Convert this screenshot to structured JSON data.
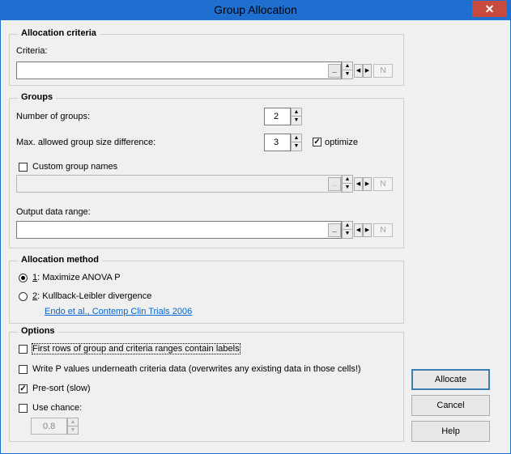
{
  "window": {
    "title": "Group Allocation",
    "close_label": "✕"
  },
  "allocation_criteria": {
    "legend": "Allocation criteria",
    "criteria_label": "Criteria:",
    "criteria_value": "",
    "collapse_label": "_",
    "n_label": "N"
  },
  "groups": {
    "legend": "Groups",
    "num_groups_label": "Number of groups:",
    "num_groups_value": "2",
    "max_diff_label": "Max. allowed group size difference:",
    "max_diff_value": "3",
    "optimize_label": "optimize",
    "optimize_checked": true,
    "custom_names_label": "Custom group names",
    "custom_names_checked": false,
    "custom_names_value": "",
    "output_label": "Output data range:",
    "output_value": "",
    "collapse_label": "_",
    "n_label": "N"
  },
  "allocation_method": {
    "legend": "Allocation method",
    "options": [
      {
        "key": "1",
        "label": ": Maximize ANOVA P",
        "selected": true
      },
      {
        "key": "2",
        "label": ": Kullback-Leibler divergence",
        "selected": false
      }
    ],
    "reference_link": "Endo et al., Contemp Clin Trials 2006"
  },
  "options": {
    "legend": "Options",
    "first_rows_label": "First rows of group and criteria ranges contain labels",
    "first_rows_checked": false,
    "write_p_label": "Write P values underneath criteria data (overwrites any existing data in those cells!)",
    "write_p_checked": false,
    "presort_label": "Pre-sort (slow)",
    "presort_checked": true,
    "use_chance_label": "Use chance:",
    "use_chance_checked": false,
    "chance_value": "0.8"
  },
  "buttons": {
    "allocate": "Allocate",
    "cancel": "Cancel",
    "help": "Help"
  },
  "check_mark": "✓",
  "arrows": {
    "up": "▲",
    "down": "▼",
    "left": "◀",
    "right": "▶"
  }
}
